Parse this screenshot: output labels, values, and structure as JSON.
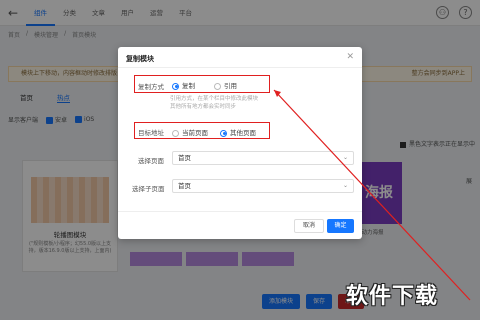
{
  "header": {
    "nav": [
      "组件",
      "分类",
      "文章",
      "用户",
      "运营",
      "平台"
    ],
    "active_index": 0
  },
  "breadcrumb": [
    "首页",
    "模块管理",
    "首页模块"
  ],
  "notice": {
    "text": "模块上下移动，内容框动时修改排版，请前往排版管理中",
    "tail": "整方会同步到APP上"
  },
  "tabs": [
    "首页",
    "热点"
  ],
  "filters": [
    "显示客户端",
    "安卓",
    "iOS"
  ],
  "legend_text": "黑色文字表示正在显示中",
  "left_card": {
    "title": "轮播图模块",
    "desc": "(\"规则模板/小程序；幻55.0版以上支持，版本16.9.0版以上支持，上面内)"
  },
  "poster": {
    "text": "海报",
    "caption": "东动力海报"
  },
  "strip_cards": [
    "",
    "",
    ""
  ],
  "side_label": "展",
  "bottom_buttons": [
    "添加模块",
    "保存",
    "取消"
  ],
  "modal": {
    "title": "复制模块",
    "copy_mode_label": "复制方式",
    "copy_mode_options": [
      "复制",
      "引用"
    ],
    "copy_mode_selected": 0,
    "hint_line1": "引用方式，在某个栏目中修改此模块",
    "hint_line2": "其他所有地方都会实时同步",
    "target_label": "目标地址",
    "target_options": [
      "当前页面",
      "其他页面"
    ],
    "target_selected": 1,
    "page_label": "选择页面",
    "page_value": "首页",
    "subpage_label": "选择子页面",
    "subpage_value": "首页",
    "cancel_label": "取消",
    "ok_label": "确定"
  },
  "watermark": "软件下载",
  "colors": {
    "accent": "#1677ff",
    "highlight": "#e02020"
  }
}
